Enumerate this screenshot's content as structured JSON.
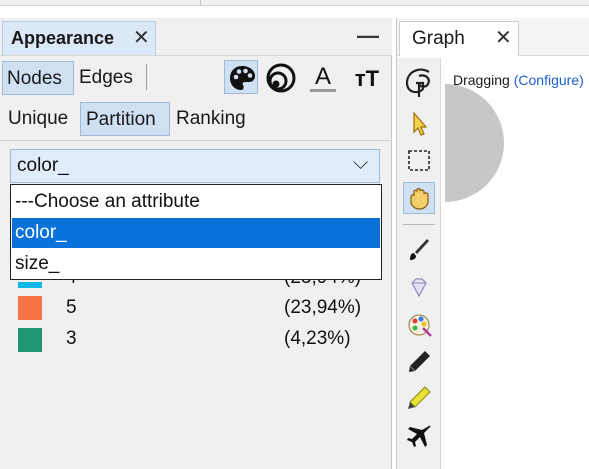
{
  "appearance": {
    "title": "Appearance",
    "close_glyph": "✕",
    "minimize_glyph": "—",
    "element_tabs": [
      "Nodes",
      "Edges"
    ],
    "toolbar_icons": [
      "palette-icon",
      "size-rings-icon",
      "label-color-icon",
      "label-size-icon"
    ],
    "label_color_glyph": "A",
    "label_size_glyph": "ᴛT",
    "mode_tabs": [
      "Unique",
      "Partition",
      "Ranking"
    ],
    "attribute_select": {
      "value": "color_",
      "arrow": "⌵",
      "options": [
        "---Choose an attribute",
        "color_",
        "size_"
      ],
      "highlighted_index": 1
    },
    "partition_rows": [
      {
        "value": "5",
        "percent": "(23,94%)",
        "color": "#f87446"
      },
      {
        "value": "3",
        "percent": "(4,23%)",
        "color": "#1e9573"
      }
    ],
    "partially_hidden_row": {
      "value": "4",
      "percent": "(23,94%)",
      "color": "#10b7e6"
    },
    "colors": {
      "selected": "#0a72d8",
      "active_button": "#cfe0f3",
      "node_gray": "#c7c7c7"
    }
  },
  "graph": {
    "title": "Graph",
    "close_glyph": "✕",
    "status_label": "Dragging",
    "config_link": "(Configure)",
    "tools": [
      "graph-logo-icon",
      "pointer-arrow-icon",
      "rectangle-select-icon",
      "hand-drag-icon",
      "paintbrush-icon",
      "diamond-icon",
      "node-color-palette-icon",
      "pencil-icon",
      "highlighter-icon",
      "airplane-icon"
    ]
  }
}
